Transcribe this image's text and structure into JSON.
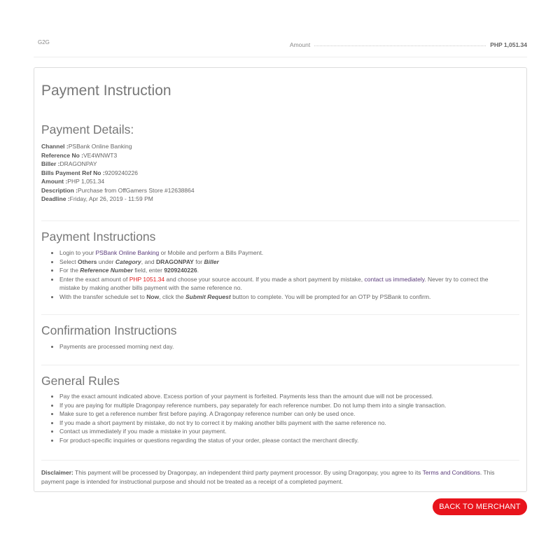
{
  "header": {
    "merchant": "G2G",
    "amount_label": "Amount",
    "amount_value": "PHP 1,051.34"
  },
  "page_title": "Payment Instruction",
  "payment_details": {
    "title": "Payment Details:",
    "rows": [
      {
        "key": "Channel :",
        "value": "PSBank Online Banking"
      },
      {
        "key": "Reference No :",
        "value": "VE4WNWT3"
      },
      {
        "key": "Biller :",
        "value": "DRAGONPAY"
      },
      {
        "key": "Bills Payment Ref No :",
        "value": "9209240226"
      },
      {
        "key": "Amount :",
        "value": "PHP 1,051.34"
      },
      {
        "key": "Description :",
        "value": "Purchase from OffGamers Store #12638864"
      },
      {
        "key": "Deadline :",
        "value": "Friday, Apr 26, 2019 - 11:59 PM"
      }
    ]
  },
  "payment_instructions": {
    "title": "Payment Instructions",
    "i1_a": "Login to your ",
    "i1_link": "PSBank Online Banking",
    "i1_b": " or Mobile and perform a Bills Payment.",
    "i2_a": "Select ",
    "i2_b": "Others",
    "i2_c": " under ",
    "i2_d": "Category",
    "i2_e": ", and ",
    "i2_f": "DRAGONPAY",
    "i2_g": " for ",
    "i2_h": "Biller",
    "i3_a": "For the ",
    "i3_b": "Reference Number",
    "i3_c": " field, enter ",
    "i3_d": "9209240226",
    "i3_e": ".",
    "i4_a": "Enter the exact amount of ",
    "i4_amount": "PHP 1051.34",
    "i4_b": " and choose your source account. If you made a short payment by mistake, ",
    "i4_link": "contact us immediately",
    "i4_c": ". Never try to correct the mistake by making another bills payment with the same reference no.",
    "i5_a": "With the transfer schedule set to ",
    "i5_b": "Now",
    "i5_c": ", click the ",
    "i5_d": "Submit Request",
    "i5_e": " button to complete. You will be prompted for an OTP by PSBank to confirm."
  },
  "confirmation": {
    "title": "Confirmation Instructions",
    "items": [
      "Payments are processed morning next day."
    ]
  },
  "general_rules": {
    "title": "General Rules",
    "items": [
      "Pay the exact amount indicated above. Excess portion of your payment is forfeited. Payments less than the amount due will not be processed.",
      "If you are paying for multiple Dragonpay reference numbers, pay separately for each reference number. Do not lump them into a single transaction.",
      "Make sure to get a reference number first before paying. A Dragonpay reference number can only be used once.",
      "If you made a short payment by mistake, do not try to correct it by making another bills payment with the same reference no.",
      "Contact us immediately if you made a mistake in your payment.",
      "For product-specific inquiries or questions regarding the status of your order, please contact the merchant directly."
    ]
  },
  "disclaimer": {
    "label": "Disclaimer:",
    "text_a": " This payment will be processed by Dragonpay, an independent third party payment processor. By using Dragonpay, you agree to its ",
    "link": "Terms and Conditions",
    "text_b": ". This payment page is intended for instructional purpose and should not be treated as a receipt of a completed payment."
  },
  "back_button": "BACK TO MERCHANT",
  "colors": {
    "accent_red": "#e8141c",
    "link_purple": "#5a3b7a",
    "amount_red": "#e02020"
  }
}
